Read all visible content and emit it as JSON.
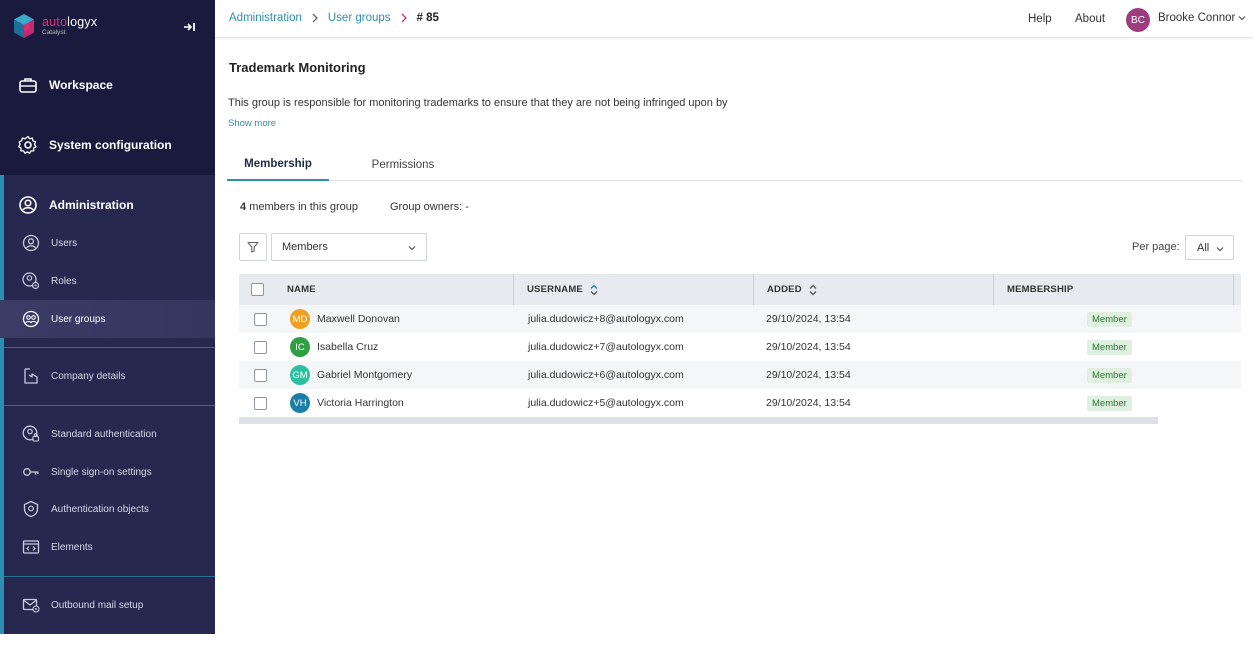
{
  "brand": {
    "name_prefix": "auto",
    "name_suffix": "logyx",
    "tagline": "Catalyst"
  },
  "sidebar": {
    "workspace": "Workspace",
    "system_configuration": "System configuration",
    "administration": "Administration",
    "items": [
      {
        "label": "Users",
        "icon": "user-icon"
      },
      {
        "label": "Roles",
        "icon": "roles-icon"
      },
      {
        "label": "User groups",
        "icon": "user-groups-icon"
      },
      {
        "label": "Company details",
        "icon": "company-icon"
      },
      {
        "label": "Standard authentication",
        "icon": "standard-auth-icon"
      },
      {
        "label": "Single sign-on settings",
        "icon": "key-icon"
      },
      {
        "label": "Authentication objects",
        "icon": "shield-icon"
      },
      {
        "label": "Elements",
        "icon": "elements-icon"
      },
      {
        "label": "Outbound mail setup",
        "icon": "mail-icon"
      }
    ]
  },
  "header": {
    "breadcrumb": [
      "Administration",
      "User groups",
      "# 85"
    ],
    "help": "Help",
    "about": "About",
    "user": {
      "initials": "BC",
      "name": "Brooke Connor"
    }
  },
  "group": {
    "title": "Trademark Monitoring",
    "description": "This group is responsible for monitoring trademarks to ensure that they are not being infringed upon by",
    "show_more": "Show more"
  },
  "tabs": [
    "Membership",
    "Permissions"
  ],
  "membership": {
    "count": "4",
    "count_suffix": "members in this group",
    "owners": "Group owners: -",
    "filter_value": "Members",
    "per_page_label": "Per page:",
    "per_page_value": "All"
  },
  "table": {
    "columns": [
      "NAME",
      "USERNAME",
      "ADDED",
      "MEMBERSHIP"
    ],
    "rows": [
      {
        "initials": "MD",
        "color": "#f0a020",
        "name": "Maxwell Donovan",
        "username": "julia.dudowicz+8@autologyx.com",
        "added": "29/10/2024, 13:54",
        "membership": "Member"
      },
      {
        "initials": "IC",
        "color": "#2ea043",
        "name": "Isabella Cruz",
        "username": "julia.dudowicz+7@autologyx.com",
        "added": "29/10/2024, 13:54",
        "membership": "Member"
      },
      {
        "initials": "GM",
        "color": "#2bc0a0",
        "name": "Gabriel Montgomery",
        "username": "julia.dudowicz+6@autologyx.com",
        "added": "29/10/2024, 13:54",
        "membership": "Member"
      },
      {
        "initials": "VH",
        "color": "#1b7fa8",
        "name": "Victoria Harrington",
        "username": "julia.dudowicz+5@autologyx.com",
        "added": "29/10/2024, 13:54",
        "membership": "Member"
      }
    ]
  },
  "colors": {
    "sidebar_bg": "#1a1a3e",
    "admin_bg": "#26284f",
    "accent": "#2d8fb0",
    "badge_bg": "#e0f0e0",
    "badge_text": "#2e7d32",
    "user_avatar": "#9c3d7d"
  }
}
